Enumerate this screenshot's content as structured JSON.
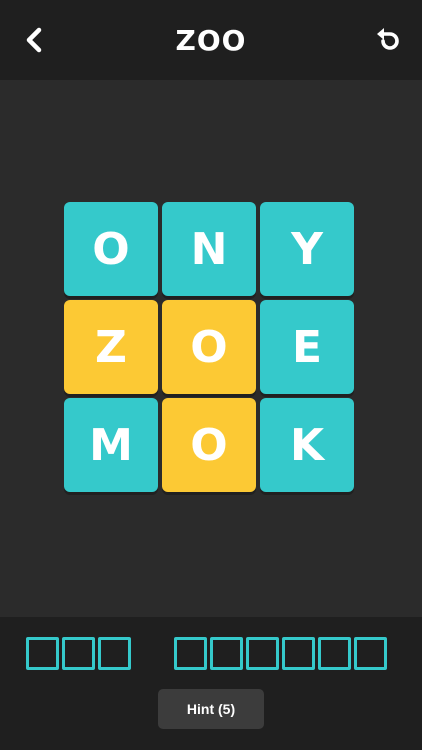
{
  "header": {
    "title": "ZOO",
    "back_icon": "chevron-left-icon",
    "undo_icon": "undo-icon"
  },
  "board": {
    "tiles": [
      {
        "letter": "O",
        "color": "teal"
      },
      {
        "letter": "N",
        "color": "teal"
      },
      {
        "letter": "Y",
        "color": "teal"
      },
      {
        "letter": "Z",
        "color": "yellow"
      },
      {
        "letter": "O",
        "color": "yellow"
      },
      {
        "letter": "E",
        "color": "teal"
      },
      {
        "letter": "M",
        "color": "teal"
      },
      {
        "letter": "O",
        "color": "yellow"
      },
      {
        "letter": "K",
        "color": "teal"
      }
    ]
  },
  "answer": {
    "word_lengths": [
      3,
      6
    ]
  },
  "hint": {
    "label": "Hint (5)"
  },
  "colors": {
    "teal": "#35c9cb",
    "yellow": "#fcc934",
    "background": "#2b2b2b",
    "panel": "#1f1f1f",
    "button": "#3c3c3c"
  }
}
